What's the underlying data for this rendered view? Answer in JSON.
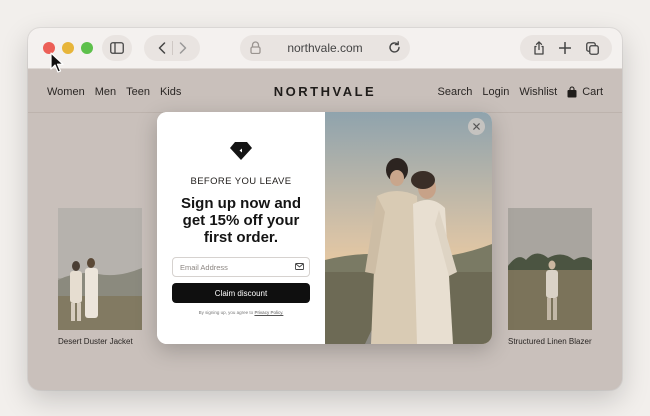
{
  "browser": {
    "url": "northvale.com",
    "icons": [
      "sidebar-icon",
      "back-icon",
      "forward-icon",
      "lock-icon",
      "reload-icon",
      "share-icon",
      "new-tab-icon",
      "tabs-icon"
    ]
  },
  "site": {
    "brand": "NORTHVALE",
    "nav_left": [
      "Women",
      "Men",
      "Teen",
      "Kids"
    ],
    "nav_right": [
      "Search",
      "Login",
      "Wishlist"
    ],
    "cart_label": "Cart"
  },
  "products": [
    {
      "name": "Desert Duster Jacket"
    },
    {
      "name": "Structured Linen Blazer"
    }
  ],
  "popup": {
    "eyebrow": "BEFORE YOU LEAVE",
    "headline_line1": "Sign up now and",
    "headline_line2": "get 15% off your",
    "headline_line3": "first order.",
    "email_placeholder": "Email Address",
    "email_value": "",
    "cta_label": "Claim discount",
    "fine_print_prefix": "By signing up, you agree to",
    "fine_print_link": "Privacy Policy."
  },
  "colors": {
    "site_background": "#c9c0bb",
    "cta_background": "#0f0f0f",
    "traffic_red": "#ec5f57",
    "traffic_yellow": "#e7b53a",
    "traffic_green": "#5dc04b"
  }
}
